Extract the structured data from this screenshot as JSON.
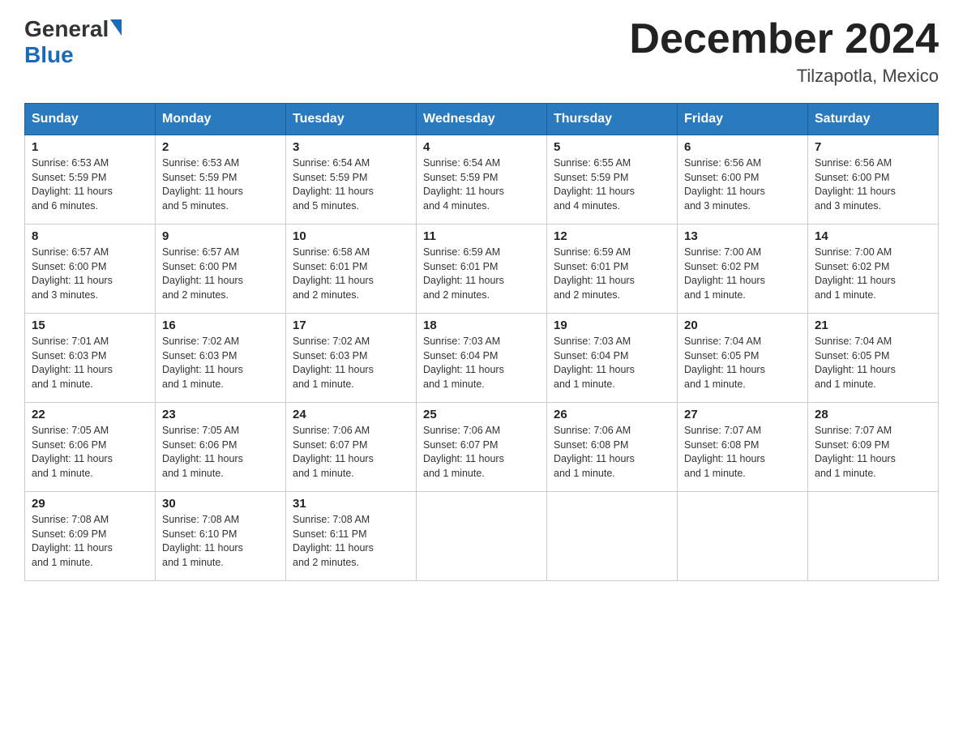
{
  "header": {
    "logo_general": "General",
    "logo_blue": "Blue",
    "month_title": "December 2024",
    "location": "Tilzapotla, Mexico"
  },
  "weekdays": [
    "Sunday",
    "Monday",
    "Tuesday",
    "Wednesday",
    "Thursday",
    "Friday",
    "Saturday"
  ],
  "weeks": [
    [
      {
        "day": "1",
        "sunrise": "6:53 AM",
        "sunset": "5:59 PM",
        "daylight": "11 hours and 6 minutes."
      },
      {
        "day": "2",
        "sunrise": "6:53 AM",
        "sunset": "5:59 PM",
        "daylight": "11 hours and 5 minutes."
      },
      {
        "day": "3",
        "sunrise": "6:54 AM",
        "sunset": "5:59 PM",
        "daylight": "11 hours and 5 minutes."
      },
      {
        "day": "4",
        "sunrise": "6:54 AM",
        "sunset": "5:59 PM",
        "daylight": "11 hours and 4 minutes."
      },
      {
        "day": "5",
        "sunrise": "6:55 AM",
        "sunset": "5:59 PM",
        "daylight": "11 hours and 4 minutes."
      },
      {
        "day": "6",
        "sunrise": "6:56 AM",
        "sunset": "6:00 PM",
        "daylight": "11 hours and 3 minutes."
      },
      {
        "day": "7",
        "sunrise": "6:56 AM",
        "sunset": "6:00 PM",
        "daylight": "11 hours and 3 minutes."
      }
    ],
    [
      {
        "day": "8",
        "sunrise": "6:57 AM",
        "sunset": "6:00 PM",
        "daylight": "11 hours and 3 minutes."
      },
      {
        "day": "9",
        "sunrise": "6:57 AM",
        "sunset": "6:00 PM",
        "daylight": "11 hours and 2 minutes."
      },
      {
        "day": "10",
        "sunrise": "6:58 AM",
        "sunset": "6:01 PM",
        "daylight": "11 hours and 2 minutes."
      },
      {
        "day": "11",
        "sunrise": "6:59 AM",
        "sunset": "6:01 PM",
        "daylight": "11 hours and 2 minutes."
      },
      {
        "day": "12",
        "sunrise": "6:59 AM",
        "sunset": "6:01 PM",
        "daylight": "11 hours and 2 minutes."
      },
      {
        "day": "13",
        "sunrise": "7:00 AM",
        "sunset": "6:02 PM",
        "daylight": "11 hours and 1 minute."
      },
      {
        "day": "14",
        "sunrise": "7:00 AM",
        "sunset": "6:02 PM",
        "daylight": "11 hours and 1 minute."
      }
    ],
    [
      {
        "day": "15",
        "sunrise": "7:01 AM",
        "sunset": "6:03 PM",
        "daylight": "11 hours and 1 minute."
      },
      {
        "day": "16",
        "sunrise": "7:02 AM",
        "sunset": "6:03 PM",
        "daylight": "11 hours and 1 minute."
      },
      {
        "day": "17",
        "sunrise": "7:02 AM",
        "sunset": "6:03 PM",
        "daylight": "11 hours and 1 minute."
      },
      {
        "day": "18",
        "sunrise": "7:03 AM",
        "sunset": "6:04 PM",
        "daylight": "11 hours and 1 minute."
      },
      {
        "day": "19",
        "sunrise": "7:03 AM",
        "sunset": "6:04 PM",
        "daylight": "11 hours and 1 minute."
      },
      {
        "day": "20",
        "sunrise": "7:04 AM",
        "sunset": "6:05 PM",
        "daylight": "11 hours and 1 minute."
      },
      {
        "day": "21",
        "sunrise": "7:04 AM",
        "sunset": "6:05 PM",
        "daylight": "11 hours and 1 minute."
      }
    ],
    [
      {
        "day": "22",
        "sunrise": "7:05 AM",
        "sunset": "6:06 PM",
        "daylight": "11 hours and 1 minute."
      },
      {
        "day": "23",
        "sunrise": "7:05 AM",
        "sunset": "6:06 PM",
        "daylight": "11 hours and 1 minute."
      },
      {
        "day": "24",
        "sunrise": "7:06 AM",
        "sunset": "6:07 PM",
        "daylight": "11 hours and 1 minute."
      },
      {
        "day": "25",
        "sunrise": "7:06 AM",
        "sunset": "6:07 PM",
        "daylight": "11 hours and 1 minute."
      },
      {
        "day": "26",
        "sunrise": "7:06 AM",
        "sunset": "6:08 PM",
        "daylight": "11 hours and 1 minute."
      },
      {
        "day": "27",
        "sunrise": "7:07 AM",
        "sunset": "6:08 PM",
        "daylight": "11 hours and 1 minute."
      },
      {
        "day": "28",
        "sunrise": "7:07 AM",
        "sunset": "6:09 PM",
        "daylight": "11 hours and 1 minute."
      }
    ],
    [
      {
        "day": "29",
        "sunrise": "7:08 AM",
        "sunset": "6:09 PM",
        "daylight": "11 hours and 1 minute."
      },
      {
        "day": "30",
        "sunrise": "7:08 AM",
        "sunset": "6:10 PM",
        "daylight": "11 hours and 1 minute."
      },
      {
        "day": "31",
        "sunrise": "7:08 AM",
        "sunset": "6:11 PM",
        "daylight": "11 hours and 2 minutes."
      },
      null,
      null,
      null,
      null
    ]
  ],
  "labels": {
    "sunrise": "Sunrise:",
    "sunset": "Sunset:",
    "daylight": "Daylight:"
  }
}
